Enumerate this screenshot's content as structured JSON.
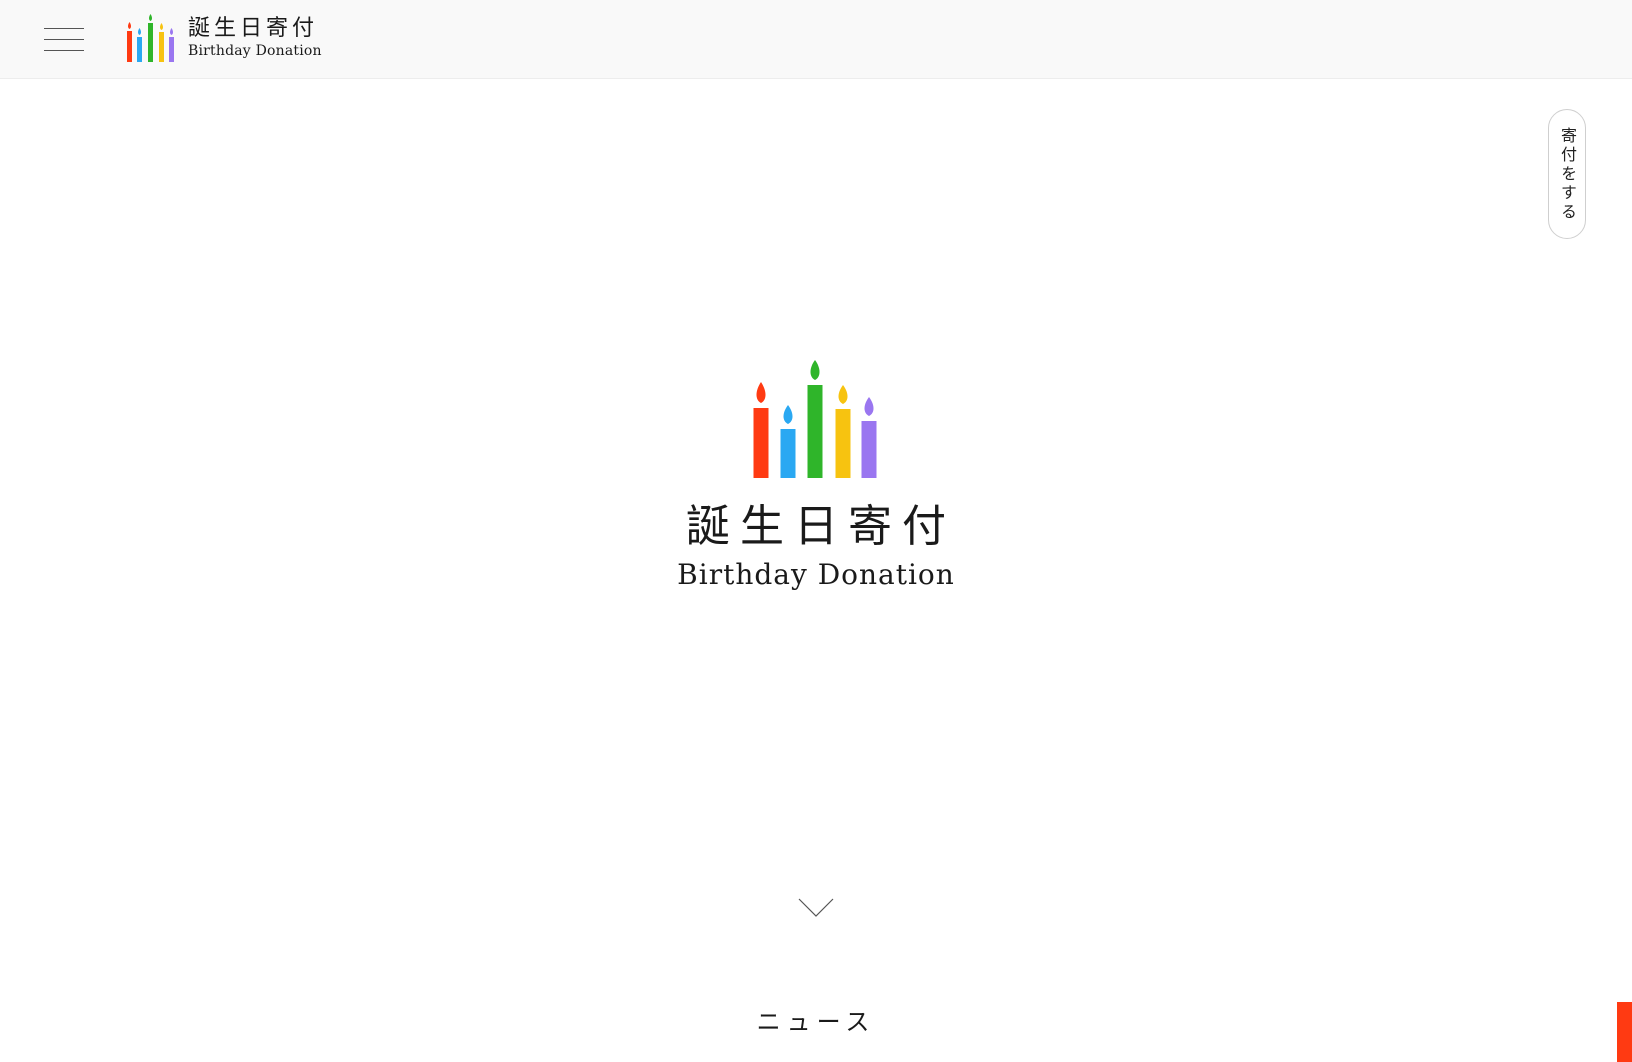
{
  "header": {
    "menu_icon": "hamburger-menu-icon",
    "logo_jp": "誕生日寄付",
    "logo_en": "Birthday Donation"
  },
  "donate_button": {
    "label": "寄付をする"
  },
  "hero": {
    "title_jp": "誕生日寄付",
    "title_en": "Birthday Donation",
    "scroll_icon": "chevron-down-icon"
  },
  "news": {
    "heading": "ニュース"
  },
  "colors": {
    "candle_red": "#ff3a12",
    "candle_blue": "#2aa8f2",
    "candle_green": "#2fb52a",
    "candle_yellow": "#f7c310",
    "candle_purple": "#9a76f0",
    "header_bg": "#f9f9f9",
    "side_tab": "#ff3a12"
  }
}
